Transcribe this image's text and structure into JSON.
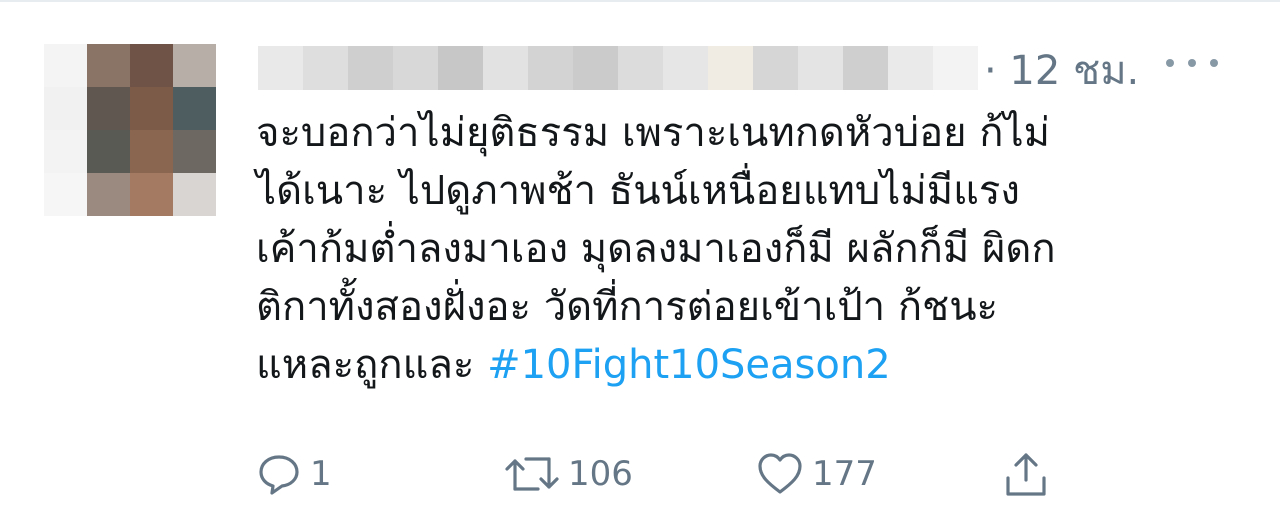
{
  "tweet": {
    "timestamp": "· 12 ชม.",
    "more_icon": "more-horizontal-icon",
    "body_lines": [
      "จะบอกว่าไม่ยุติธรรม เพราะเนทกดหัวบ่อย ก้ไม่",
      "ได้เนาะ ไปดูภาพช้า ธันน์เหนื่อยแทบไม่มีแรง",
      "เค้าก้มต่ำลงมาเอง มุดลงมาเองก็มี ผลักก็มี ผิดก",
      "ติกาทั้งสองฝั่งอะ  วัดที่การต่อยเข้าเป้า ก้ชนะ"
    ],
    "last_line_prefix": "แหละถูกและ ",
    "hashtag": "#10Fight10Season2",
    "colors": {
      "text": "#14171a",
      "muted": "#657786",
      "link": "#1da1f2"
    }
  },
  "actions": {
    "reply": {
      "icon": "reply-icon",
      "count": "1"
    },
    "retweet": {
      "icon": "retweet-icon",
      "count": "106"
    },
    "like": {
      "icon": "heart-icon",
      "count": "177"
    },
    "share": {
      "icon": "share-icon"
    }
  }
}
